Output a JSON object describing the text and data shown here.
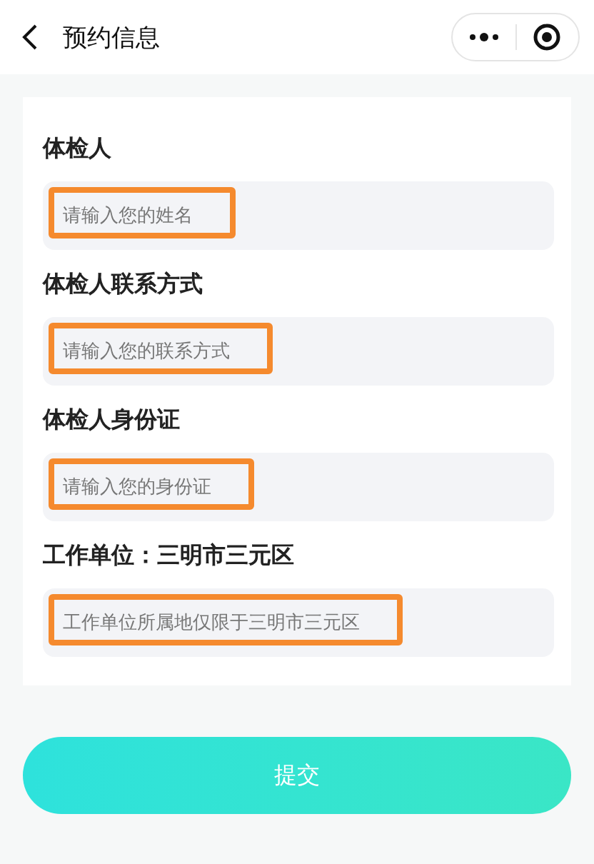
{
  "header": {
    "title": "预约信息"
  },
  "fields": [
    {
      "label": "体检人",
      "placeholder": "请输入您的姓名",
      "highlighted": true
    },
    {
      "label": "体检人联系方式",
      "placeholder": "请输入您的联系方式",
      "highlighted": true
    },
    {
      "label": "体检人身份证",
      "placeholder": "请输入您的身份证",
      "highlighted": true
    },
    {
      "label": "工作单位：三明市三元区",
      "placeholder": "工作单位所属地仅限于三明市三元区",
      "highlighted": true
    }
  ],
  "submit_button": "提交"
}
